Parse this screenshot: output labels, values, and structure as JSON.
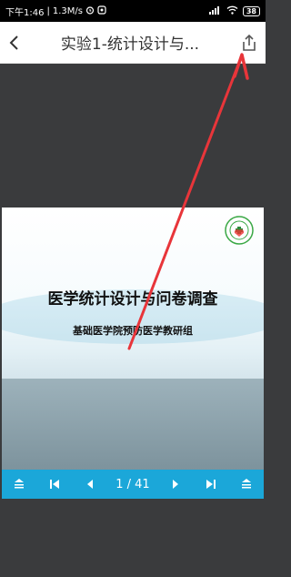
{
  "status": {
    "time": "下午1:46",
    "speed": "1.3M/s",
    "battery": "38"
  },
  "app_bar": {
    "title": "实验1-统计设计与..."
  },
  "slide": {
    "title": "医学统计设计与问卷调查",
    "subtitle": "基础医学院预防医学教研组"
  },
  "toolbar": {
    "page_indicator": "1 / 41"
  },
  "colors": {
    "toolbar": "#1ba7d9",
    "annotation_arrow": "#e8353a",
    "background": "#3a3b3d"
  }
}
